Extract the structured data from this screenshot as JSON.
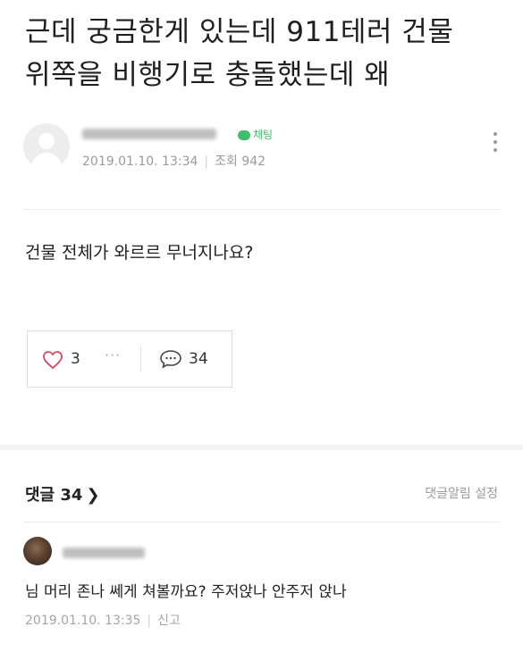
{
  "post": {
    "title_line1": "근데 궁금한게 있는데 911테러 건물",
    "title_line2": "위쪽을 비행기로 충돌했는데 왜",
    "author": {
      "chat_label": "채팅",
      "date": "2019.01.10. 13:34",
      "views_label": "조회 942"
    },
    "body": "건물 전체가 와르르 무너지나요?",
    "reactions": {
      "likes": "3",
      "more": "···",
      "comments": "34"
    }
  },
  "comments_section": {
    "header": "댓글 34",
    "chevron": "❯",
    "notification_setting": "댓글알림 설정",
    "items": [
      {
        "text": "님 머리 존나 쎄게 쳐볼까요? 주저앉나 안주저 앉나",
        "date": "2019.01.10. 13:35",
        "report": "신고"
      }
    ]
  },
  "colors": {
    "chat_green": "#3fbf6b",
    "meta_gray": "#9a9a9a",
    "heart": "#d44a60"
  },
  "icons": [
    "default-avatar-icon",
    "chat-bubble-icon",
    "more-icon",
    "heart-icon",
    "comment-icon",
    "chevron-right-icon"
  ]
}
